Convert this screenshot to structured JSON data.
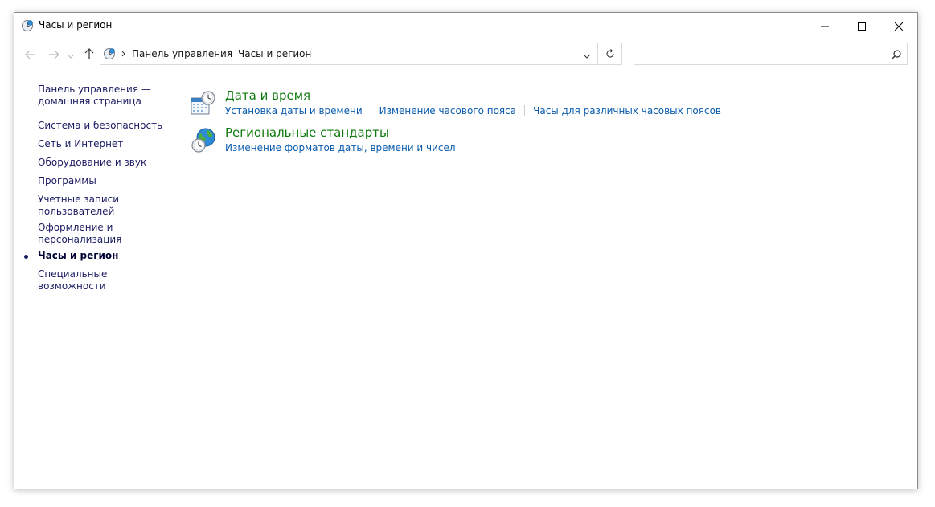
{
  "window": {
    "title": "Часы и регион"
  },
  "titlebar": {
    "minimize_icon": "minimize-icon",
    "maximize_icon": "maximize-icon",
    "close_icon": "close-icon"
  },
  "navigation": {
    "back_icon": "arrow-left-icon",
    "forward_icon": "arrow-right-icon",
    "recent_icon": "chevron-down-icon",
    "up_icon": "arrow-up-icon"
  },
  "address": {
    "breadcrumbs": [
      "Панель управления",
      "Часы и регион"
    ],
    "dropdown_icon": "chevron-down-icon",
    "refresh_icon": "refresh-icon"
  },
  "search": {
    "value": "",
    "placeholder": ""
  },
  "sidebar": {
    "home_line1": "Панель управления —",
    "home_line2": "домашняя страница",
    "items": [
      {
        "label": "Система и безопасность"
      },
      {
        "label": "Сеть и Интернет"
      },
      {
        "label": "Оборудование и звук"
      },
      {
        "label": "Программы"
      },
      {
        "label_line1": "Учетные записи",
        "label_line2": "пользователей"
      },
      {
        "label_line1": "Оформление и",
        "label_line2": "персонализация"
      },
      {
        "label": "Часы и регион",
        "current": true
      },
      {
        "label": "Специальные возможности"
      }
    ]
  },
  "categories": [
    {
      "title": "Дата и время",
      "icon": "calendar-clock-icon",
      "links": [
        "Установка даты и времени",
        "Изменение часового пояса",
        "Часы для различных часовых поясов"
      ]
    },
    {
      "title": "Региональные стандарты",
      "icon": "globe-clock-icon",
      "links": [
        "Изменение форматов даты, времени и чисел"
      ]
    }
  ],
  "colors": {
    "category_title": "#0e7a0d",
    "link": "#0b5cad",
    "sidebar_link": "#1c1c63"
  }
}
